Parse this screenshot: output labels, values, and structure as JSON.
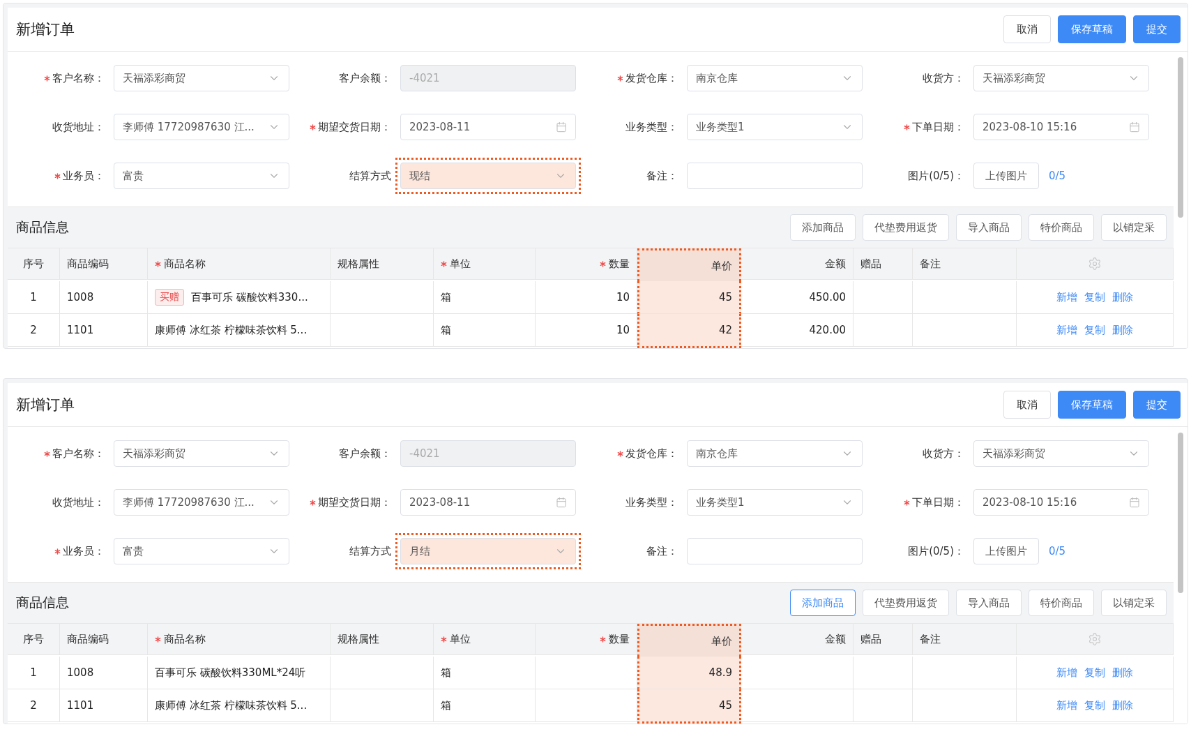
{
  "panels": [
    {
      "title": "新增订单",
      "buttons": [
        {
          "label": "取消",
          "kind": "default"
        },
        {
          "label": "保存草稿",
          "kind": "primary"
        },
        {
          "label": "提交",
          "kind": "primary"
        }
      ],
      "fields": [
        {
          "label": "客户名称：",
          "required": true,
          "kind": "select",
          "value": "天福添彩商贸",
          "highlighted": false
        },
        {
          "label": "客户余额：",
          "required": false,
          "kind": "disabled",
          "value": "-4021",
          "highlighted": false
        },
        {
          "label": "发货仓库：",
          "required": true,
          "kind": "select",
          "value": "南京仓库",
          "highlighted": false
        },
        {
          "label": "收货方：",
          "required": false,
          "kind": "select",
          "value": "天福添彩商贸",
          "highlighted": false
        },
        {
          "label": "收货地址：",
          "required": false,
          "kind": "select",
          "value": "李师傅 17720987630 江...",
          "highlighted": false
        },
        {
          "label": "期望交货日期：",
          "required": true,
          "kind": "date",
          "value": "2023-08-11",
          "highlighted": false
        },
        {
          "label": "业务类型：",
          "required": false,
          "kind": "select",
          "value": "业务类型1",
          "highlighted": false
        },
        {
          "label": "下单日期：",
          "required": true,
          "kind": "date",
          "value": "2023-08-10 15:16",
          "highlighted": false
        },
        {
          "label": "业务员：",
          "required": true,
          "kind": "select",
          "value": "富贵",
          "highlighted": false
        },
        {
          "label": "结算方式",
          "required": false,
          "kind": "select",
          "value": "现结",
          "highlighted": true
        },
        {
          "label": "备注：",
          "required": false,
          "kind": "input",
          "highlighted": false
        },
        {
          "label": "图片(0/5)：",
          "required": false,
          "kind": "upload",
          "value": "上传图片",
          "count": "0/5",
          "highlighted": false
        }
      ],
      "section_title": "商品信息",
      "toolbar_buttons": [
        {
          "label": "添加商品",
          "selected": false
        },
        {
          "label": "代垫费用返货",
          "selected": false
        },
        {
          "label": "导入商品",
          "selected": false
        },
        {
          "label": "特价商品",
          "selected": false
        },
        {
          "label": "以销定采",
          "selected": false
        }
      ],
      "columns": [
        {
          "label": "序号",
          "required": false,
          "highlighted": false
        },
        {
          "label": "商品编码",
          "required": false,
          "highlighted": false
        },
        {
          "label": "商品名称",
          "required": true,
          "highlighted": false
        },
        {
          "label": "规格属性",
          "required": false,
          "highlighted": false
        },
        {
          "label": "单位",
          "required": true,
          "highlighted": false
        },
        {
          "label": "数量",
          "required": true,
          "highlighted": false
        },
        {
          "label": "单价",
          "required": false,
          "highlighted": true
        },
        {
          "label": "金额",
          "required": false,
          "highlighted": false
        },
        {
          "label": "赠品",
          "required": false,
          "highlighted": false
        },
        {
          "label": "备注",
          "required": false,
          "highlighted": false
        }
      ],
      "rows": [
        {
          "cells": [
            "1",
            "1008",
            "百事可乐 碳酸饮料330...",
            "",
            "箱",
            "10",
            "45",
            "450.00",
            "",
            ""
          ],
          "tag": "买赠",
          "actions": [
            "新增",
            "复制",
            "删除"
          ]
        },
        {
          "cells": [
            "2",
            "1101",
            "康师傅 冰红茶 柠檬味茶饮料 5...",
            "",
            "箱",
            "10",
            "42",
            "420.00",
            "",
            ""
          ],
          "actions": [
            "新增",
            "复制",
            "删除"
          ]
        }
      ]
    },
    {
      "title": "新增订单",
      "buttons": [
        {
          "label": "取消",
          "kind": "default"
        },
        {
          "label": "保存草稿",
          "kind": "primary"
        },
        {
          "label": "提交",
          "kind": "primary"
        }
      ],
      "fields": [
        {
          "label": "客户名称：",
          "required": true,
          "kind": "select",
          "value": "天福添彩商贸",
          "highlighted": false
        },
        {
          "label": "客户余额：",
          "required": false,
          "kind": "disabled",
          "value": "-4021",
          "highlighted": false
        },
        {
          "label": "发货仓库：",
          "required": true,
          "kind": "select",
          "value": "南京仓库",
          "highlighted": false
        },
        {
          "label": "收货方：",
          "required": false,
          "kind": "select",
          "value": "天福添彩商贸",
          "highlighted": false
        },
        {
          "label": "收货地址：",
          "required": false,
          "kind": "select",
          "value": "李师傅 17720987630 江...",
          "highlighted": false
        },
        {
          "label": "期望交货日期：",
          "required": true,
          "kind": "date",
          "value": "2023-08-11",
          "highlighted": false
        },
        {
          "label": "业务类型：",
          "required": false,
          "kind": "select",
          "value": "业务类型1",
          "highlighted": false
        },
        {
          "label": "下单日期：",
          "required": true,
          "kind": "date",
          "value": "2023-08-10 15:16",
          "highlighted": false
        },
        {
          "label": "业务员：",
          "required": true,
          "kind": "select",
          "value": "富贵",
          "highlighted": false
        },
        {
          "label": "结算方式",
          "required": false,
          "kind": "select",
          "value": "月结",
          "highlighted": true
        },
        {
          "label": "备注：",
          "required": false,
          "kind": "input",
          "highlighted": false
        },
        {
          "label": "图片(0/5)：",
          "required": false,
          "kind": "upload",
          "value": "上传图片",
          "count": "0/5",
          "highlighted": false
        }
      ],
      "section_title": "商品信息",
      "toolbar_buttons": [
        {
          "label": "添加商品",
          "selected": true
        },
        {
          "label": "代垫费用返货",
          "selected": false
        },
        {
          "label": "导入商品",
          "selected": false
        },
        {
          "label": "特价商品",
          "selected": false
        },
        {
          "label": "以销定采",
          "selected": false
        }
      ],
      "columns": [
        {
          "label": "序号",
          "required": false,
          "highlighted": false
        },
        {
          "label": "商品编码",
          "required": false,
          "highlighted": false
        },
        {
          "label": "商品名称",
          "required": true,
          "highlighted": false
        },
        {
          "label": "规格属性",
          "required": false,
          "highlighted": false
        },
        {
          "label": "单位",
          "required": true,
          "highlighted": false
        },
        {
          "label": "数量",
          "required": true,
          "highlighted": false
        },
        {
          "label": "单价",
          "required": false,
          "highlighted": true
        },
        {
          "label": "金额",
          "required": false,
          "highlighted": false
        },
        {
          "label": "赠品",
          "required": false,
          "highlighted": false
        },
        {
          "label": "备注",
          "required": false,
          "highlighted": false
        }
      ],
      "rows": [
        {
          "cells": [
            "1",
            "1008",
            "百事可乐 碳酸饮料330ML*24听",
            "",
            "箱",
            "",
            "48.9",
            "",
            "",
            ""
          ],
          "actions": [
            "新增",
            "复制",
            "删除"
          ]
        },
        {
          "cells": [
            "2",
            "1101",
            "康师傅 冰红茶 柠檬味茶饮料 5...",
            "",
            "箱",
            "",
            "45",
            "",
            "",
            ""
          ],
          "actions": [
            "新增",
            "复制",
            "删除"
          ]
        }
      ]
    }
  ]
}
